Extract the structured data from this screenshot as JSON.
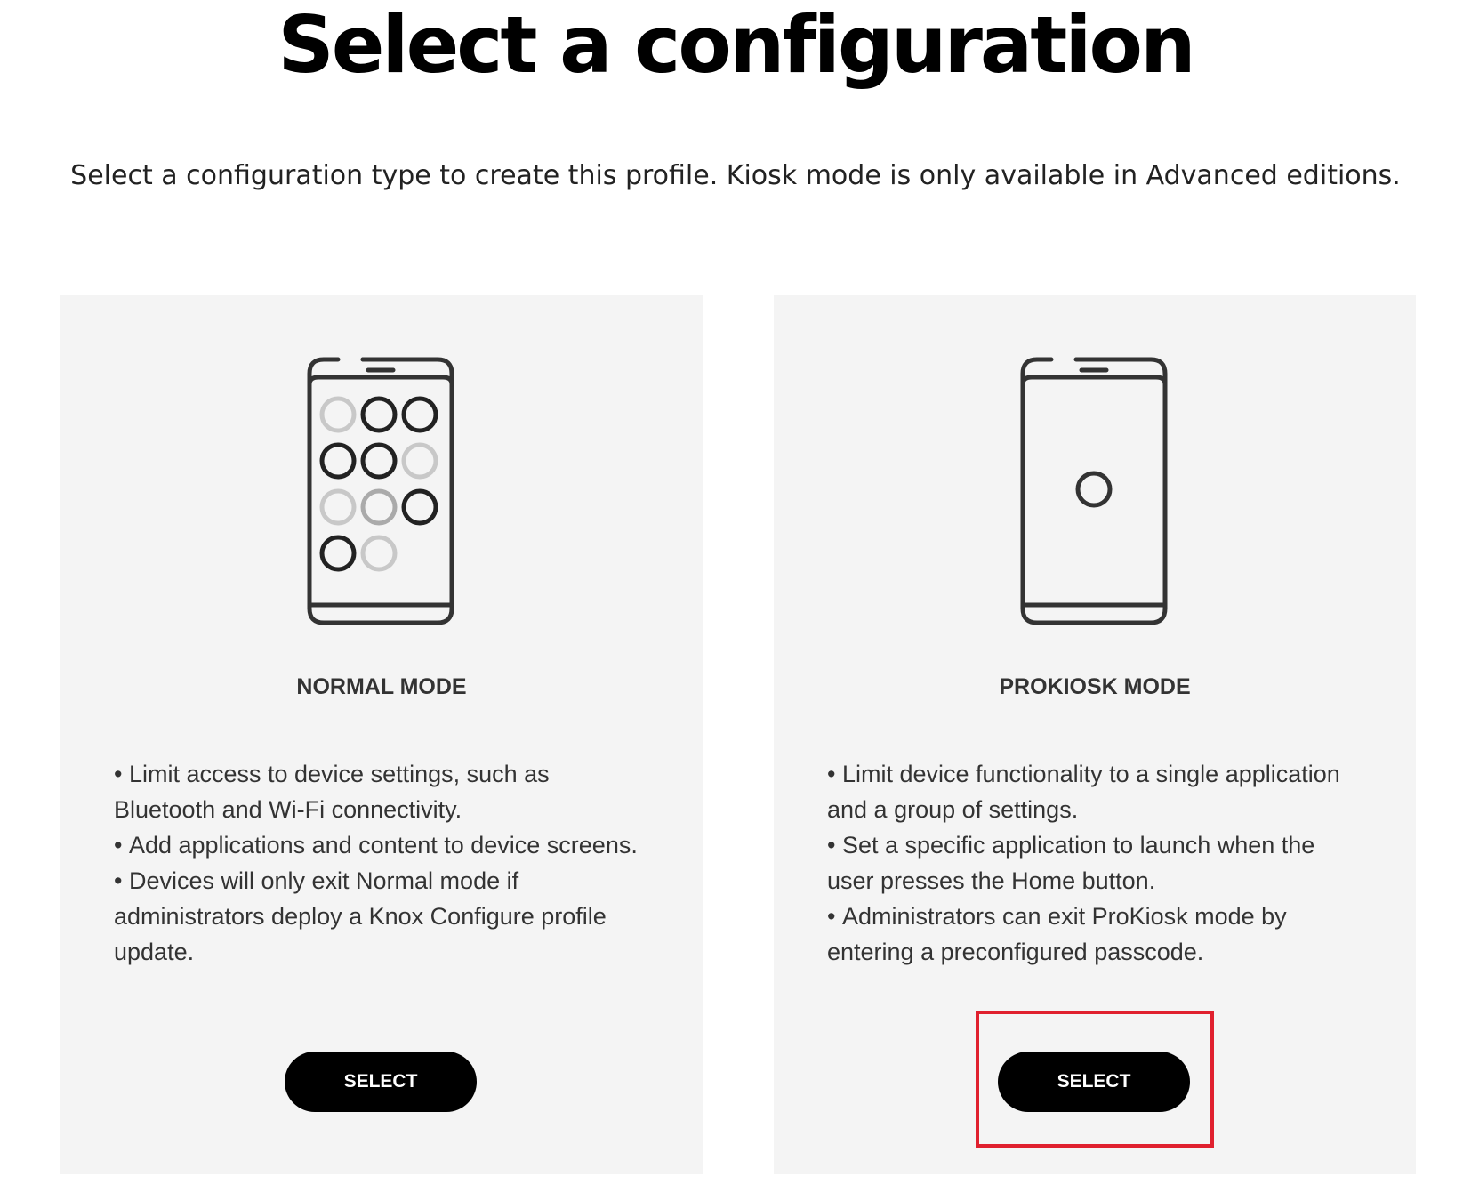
{
  "page": {
    "title": "Select a configuration",
    "subtitle": "Select a configuration type to create this profile. Kiosk mode is only available in Advanced editions."
  },
  "cards": [
    {
      "icon": "phone-app-grid-icon",
      "title": "NORMAL MODE",
      "bullets": [
        "Limit access to device settings, such as Bluetooth and Wi-Fi connectivity.",
        "Add applications and content to device screens.",
        "Devices will only exit Normal mode if administrators deploy a Knox Configure profile update."
      ],
      "button_label": "SELECT"
    },
    {
      "icon": "phone-single-app-icon",
      "title": "PROKIOSK MODE",
      "bullets": [
        "Limit device functionality to a single application and a group of settings.",
        "Set a specific application to launch when the user presses the Home button.",
        "Administrators can exit ProKiosk mode by entering a preconfigured passcode."
      ],
      "button_label": "SELECT",
      "highlighted": true
    }
  ],
  "colors": {
    "card_background": "#f4f4f4",
    "button_background": "#000000",
    "button_text": "#ffffff",
    "highlight_border": "#e0202e",
    "icon_stroke_dark": "#333333",
    "icon_stroke_light": "#c8c8c8"
  }
}
